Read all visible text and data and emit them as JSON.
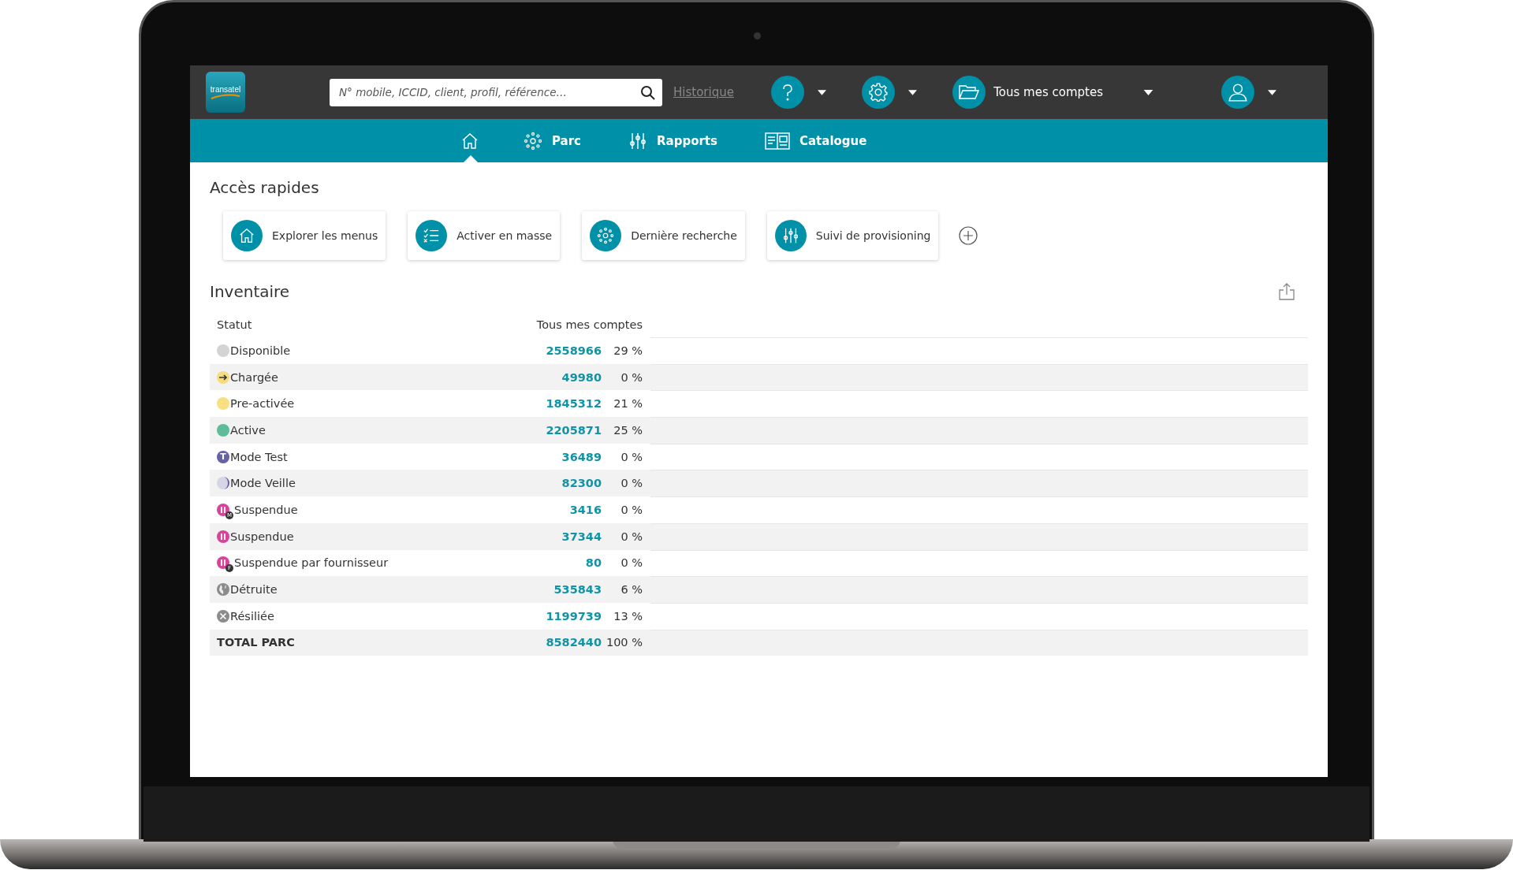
{
  "header": {
    "logo": "transatel",
    "search": {
      "placeholder": "N° mobile, ICCID, client, profil, référence…"
    },
    "history_link": "Historique",
    "account_menu": "Tous mes comptes"
  },
  "nav": [
    {
      "kind": "home",
      "selected": true
    },
    {
      "kind": "network",
      "label": "Parc",
      "selected": false
    },
    {
      "kind": "sliders",
      "label": "Rapports",
      "selected": false
    },
    {
      "kind": "catalog",
      "label": "Catalogue",
      "selected": false
    }
  ],
  "quick_access": {
    "title": "Accès rapides",
    "items": [
      {
        "kind": "home",
        "label": "Explorer les menus"
      },
      {
        "kind": "checklist",
        "label": "Activer en masse"
      },
      {
        "kind": "network",
        "label": "Dernière recherche"
      },
      {
        "kind": "sliders",
        "label": "Suivi de provisioning"
      }
    ]
  },
  "inventory": {
    "title": "Inventaire",
    "columns": [
      "Statut",
      "Tous mes comptes"
    ],
    "rows": [
      {
        "kind": "dot",
        "color": "#d4d4d4",
        "label": "Disponible",
        "count": "2558966",
        "share": "29 %"
      },
      {
        "kind": "arrow",
        "color": "#f6dc7a",
        "label": "Chargée",
        "count": "49980",
        "share": "0 %"
      },
      {
        "kind": "dot",
        "color": "#f8df80",
        "label": "Pre-activée",
        "count": "1845312",
        "share": "21 %"
      },
      {
        "kind": "dot",
        "color": "#5dbd98",
        "label": "Active",
        "count": "2205871",
        "share": "25 %"
      },
      {
        "kind": "letter",
        "color": "#6762a6",
        "letter": "T",
        "label": "Mode Test",
        "count": "36489",
        "share": "0 %"
      },
      {
        "kind": "moon",
        "color": "#6762a6",
        "label": "Mode Veille",
        "count": "82300",
        "share": "0 %"
      },
      {
        "kind": "pause",
        "color": "#d8449a",
        "badge": "M",
        "label": "Suspendue",
        "count": "3416",
        "share": "0 %"
      },
      {
        "kind": "pause",
        "color": "#d8449a",
        "label": "Suspendue",
        "count": "37344",
        "share": "0 %"
      },
      {
        "kind": "pause",
        "color": "#d8449a",
        "badge": "F",
        "label": "Suspendue par fournisseur",
        "count": "80",
        "share": "0 %"
      },
      {
        "kind": "globe",
        "color": "#8c8c8c",
        "label": "Détruite",
        "count": "535843",
        "share": "6 %"
      },
      {
        "kind": "cross",
        "color": "#8c8c8c",
        "label": "Résiliée",
        "count": "1199739",
        "share": "13 %"
      }
    ],
    "total": {
      "label": "TOTAL PARC",
      "count": "8582440",
      "share": "100 %"
    }
  }
}
